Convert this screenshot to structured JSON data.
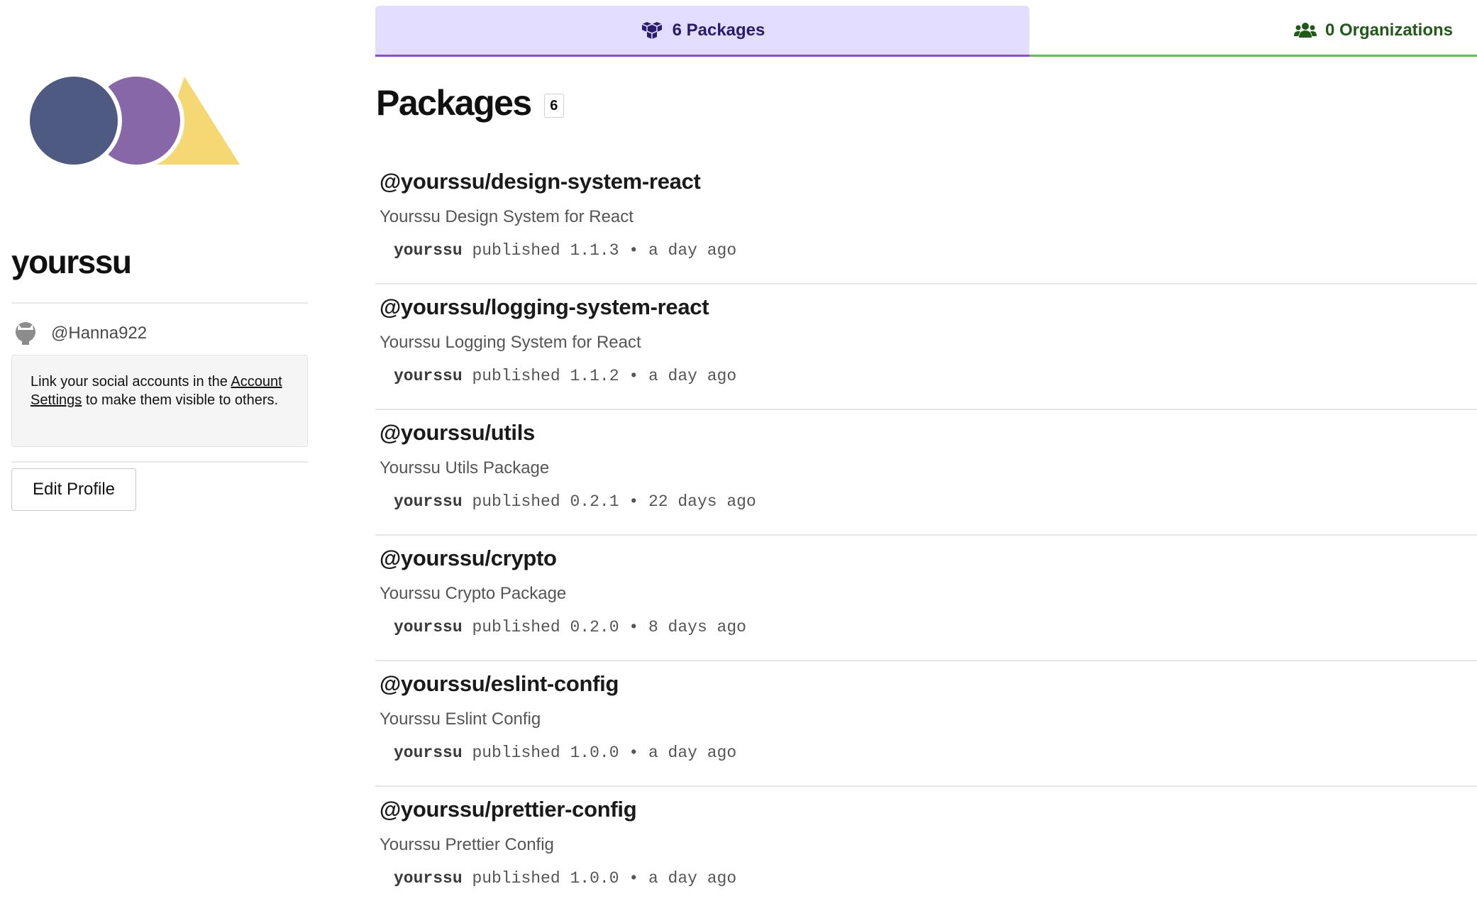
{
  "profile": {
    "username": "yourssu",
    "github_handle": "@Hanna922",
    "social_note_prefix": "Link your social accounts in the ",
    "social_note_link": "Account Settings",
    "social_note_suffix": " to make them visible to others.",
    "edit_button": "Edit Profile",
    "avatar_colors": [
      "#4f5a82",
      "#8767a8",
      "#f5d774"
    ]
  },
  "tabs": {
    "packages_label": "6 Packages",
    "organizations_label": "0 Organizations",
    "packages_accent": "#8a4bdc",
    "organizations_accent": "#5ec24a"
  },
  "main": {
    "heading": "Packages",
    "count": "6",
    "separator": "•",
    "packages": [
      {
        "name": "@yourssu/design-system-react",
        "description": "Yourssu Design System for React",
        "author": "yourssu",
        "verb": "published",
        "version": "1.1.3",
        "time": "a day ago"
      },
      {
        "name": "@yourssu/logging-system-react",
        "description": "Yourssu Logging System for React",
        "author": "yourssu",
        "verb": "published",
        "version": "1.1.2",
        "time": "a day ago"
      },
      {
        "name": "@yourssu/utils",
        "description": "Yourssu Utils Package",
        "author": "yourssu",
        "verb": "published",
        "version": "0.2.1",
        "time": "22 days ago"
      },
      {
        "name": "@yourssu/crypto",
        "description": "Yourssu Crypto Package",
        "author": "yourssu",
        "verb": "published",
        "version": "0.2.0",
        "time": "8 days ago"
      },
      {
        "name": "@yourssu/eslint-config",
        "description": "Yourssu Eslint Config",
        "author": "yourssu",
        "verb": "published",
        "version": "1.0.0",
        "time": "a day ago"
      },
      {
        "name": "@yourssu/prettier-config",
        "description": "Yourssu Prettier Config",
        "author": "yourssu",
        "verb": "published",
        "version": "1.0.0",
        "time": "a day ago"
      }
    ]
  }
}
